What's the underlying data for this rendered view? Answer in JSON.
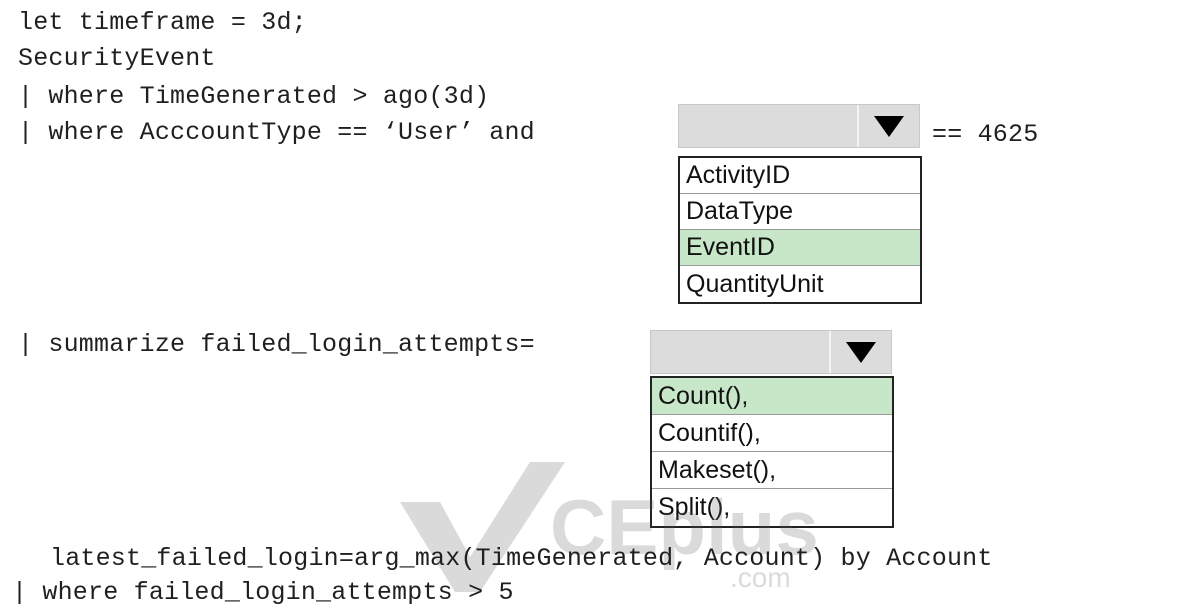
{
  "code": {
    "line1": "let timeframe = 3d;",
    "line2": "SecurityEvent",
    "line3": "| where TimeGenerated > ago(3d)",
    "line4_prefix": "| where AcccountType == ‘User’ and",
    "line4_suffix": "== 4625",
    "line5_prefix": "| summarize failed_login_attempts=",
    "line6": "latest_failed_login=arg_max(TimeGenerated, Account) by Account",
    "line7": "| where failed_login_attempts > 5"
  },
  "dropdown1": {
    "selected_value": "",
    "options": [
      "ActivityID",
      "DataType",
      "EventID",
      "QuantityUnit"
    ],
    "highlighted": "EventID"
  },
  "dropdown2": {
    "selected_value": "",
    "options": [
      "Count(),",
      "Countif(),",
      "Makeset(),",
      "Split(),"
    ],
    "highlighted": "Count(),"
  },
  "watermark": {
    "text": "CEplus",
    "subtext": ".com"
  },
  "colors": {
    "highlight": "#c7e7c8",
    "dropdown_bg": "#dcdcdc"
  },
  "icons": {
    "dropdown_arrow": "triangle-down-icon"
  }
}
